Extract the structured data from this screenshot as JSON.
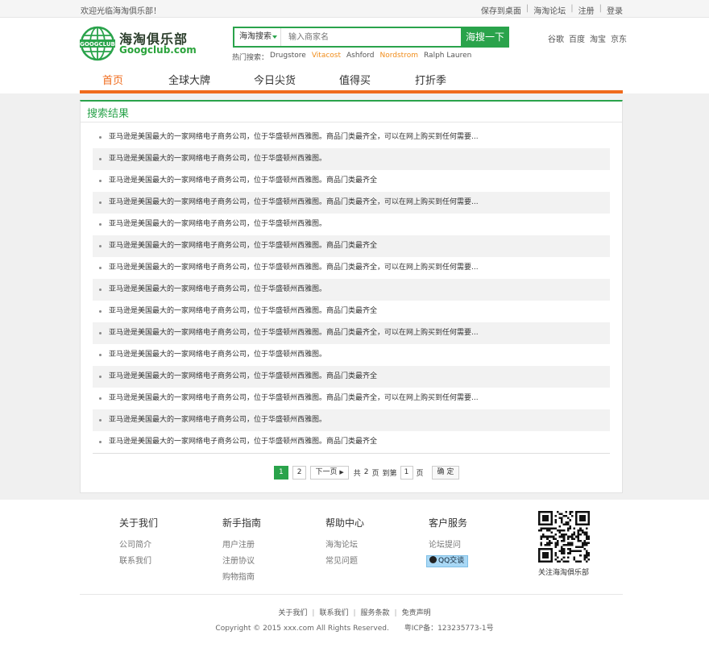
{
  "topbar": {
    "welcome": "欢迎光临海淘俱乐部！",
    "links": [
      "保存到桌面",
      "海淘论坛",
      "注册",
      "登录"
    ]
  },
  "logo": {
    "cn": "海淘俱乐部",
    "en": "Googclub.com",
    "globe_text": "GOOGCLUB"
  },
  "search": {
    "category": "海淘搜索",
    "placeholder": "输入商家名",
    "button": "海搜一下",
    "hot_label": "热门搜索：",
    "hot": [
      {
        "label": "Drugstore",
        "highlight": false
      },
      {
        "label": "Vitacost",
        "highlight": true
      },
      {
        "label": "Ashford",
        "highlight": false
      },
      {
        "label": "Nordstrom",
        "highlight": true
      },
      {
        "label": "Ralph Lauren",
        "highlight": false
      }
    ]
  },
  "quick_links": [
    "谷歌",
    "百度",
    "淘宝",
    "京东"
  ],
  "nav": [
    "首页",
    "全球大牌",
    "今日尖货",
    "值得买",
    "打折季"
  ],
  "nav_active": 0,
  "results": {
    "title": "搜索结果",
    "items": [
      "亚马逊是美国最大的一家网络电子商务公司，位于华盛顿州西雅图。商品门类最齐全，可以在网上购买到任何需要...",
      "亚马逊是美国最大的一家网络电子商务公司，位于华盛顿州西雅图。",
      "亚马逊是美国最大的一家网络电子商务公司，位于华盛顿州西雅图。商品门类最齐全",
      "亚马逊是美国最大的一家网络电子商务公司，位于华盛顿州西雅图。商品门类最齐全，可以在网上购买到任何需要...",
      "亚马逊是美国最大的一家网络电子商务公司，位于华盛顿州西雅图。",
      "亚马逊是美国最大的一家网络电子商务公司，位于华盛顿州西雅图。商品门类最齐全",
      "亚马逊是美国最大的一家网络电子商务公司，位于华盛顿州西雅图。商品门类最齐全，可以在网上购买到任何需要...",
      "亚马逊是美国最大的一家网络电子商务公司，位于华盛顿州西雅图。",
      "亚马逊是美国最大的一家网络电子商务公司，位于华盛顿州西雅图。商品门类最齐全",
      "亚马逊是美国最大的一家网络电子商务公司，位于华盛顿州西雅图。商品门类最齐全，可以在网上购买到任何需要...",
      "亚马逊是美国最大的一家网络电子商务公司，位于华盛顿州西雅图。",
      "亚马逊是美国最大的一家网络电子商务公司，位于华盛顿州西雅图。商品门类最齐全",
      "亚马逊是美国最大的一家网络电子商务公司，位于华盛顿州西雅图。商品门类最齐全，可以在网上购买到任何需要...",
      "亚马逊是美国最大的一家网络电子商务公司，位于华盛顿州西雅图。",
      "亚马逊是美国最大的一家网络电子商务公司，位于华盛顿州西雅图。商品门类最齐全"
    ]
  },
  "pager": {
    "pages": [
      "1",
      "2"
    ],
    "current": "1",
    "next": "下一页",
    "total_prefix": "共",
    "total": "2",
    "total_suffix": "页",
    "goto_label": "到第",
    "goto_value": "1",
    "goto_suffix": "页",
    "confirm": "确 定"
  },
  "footer": {
    "columns": [
      {
        "title": "关于我们",
        "links": [
          "公司简介",
          "联系我们"
        ]
      },
      {
        "title": "新手指南",
        "links": [
          "用户注册",
          "注册协议",
          "购物指南"
        ]
      },
      {
        "title": "帮助中心",
        "links": [
          "海淘论坛",
          "常见问题"
        ]
      },
      {
        "title": "客户服务",
        "links": [
          "论坛提问"
        ],
        "qq": "QQ交谈"
      }
    ],
    "qr_caption": "关注海淘俱乐部",
    "bottom_links": [
      "关于我们",
      "联系我们",
      "服务条款",
      "免责声明"
    ],
    "copyright": "Copyright © 2015 xxx.com All Rights Reserved.",
    "icp": "粤ICP备：123235773-1号"
  },
  "colors": {
    "brand_green": "#2aa34b",
    "accent_orange": "#f06b1c"
  }
}
